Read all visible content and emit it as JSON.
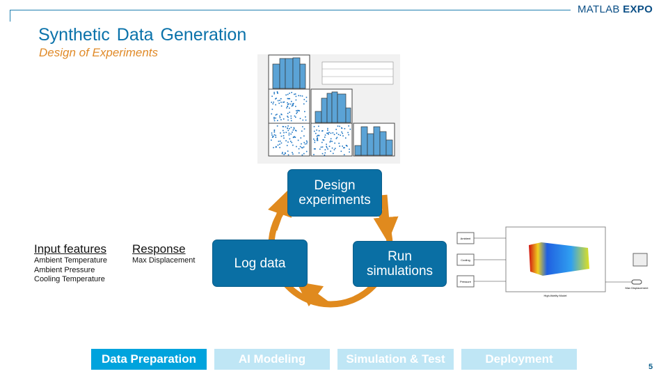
{
  "header": {
    "logo_text_1": "MATLAB",
    "logo_text_2": "EXPO",
    "title": "Synthetic Data Generation",
    "subtitle": "Design of Experiments"
  },
  "cycle": {
    "steps": [
      {
        "label": "Design experiments"
      },
      {
        "label": "Run simulations"
      },
      {
        "label": "Log data"
      }
    ],
    "arrow_color": "#e08a1e",
    "box_color": "#0a6fa4"
  },
  "features": {
    "input_heading": "Input features",
    "inputs": [
      "Ambient Temperature",
      "Ambient Pressure",
      "Cooling Temperature"
    ],
    "response_heading": "Response",
    "responses": [
      "Max Displacement"
    ]
  },
  "model_diagram": {
    "inputs": [
      "Ambient",
      "Cooling",
      "Pressure"
    ],
    "model_label": "High-fidelity Model",
    "output": "Max Displacement"
  },
  "workflow_tabs": [
    {
      "label": "Data Preparation",
      "active": true
    },
    {
      "label": "AI Modeling",
      "active": false
    },
    {
      "label": "Simulation & Test",
      "active": false
    },
    {
      "label": "Deployment",
      "active": false
    }
  ],
  "tab_colors": {
    "active": "#00a3dd",
    "inactive": "#bfe6f5"
  },
  "page_number": "5"
}
